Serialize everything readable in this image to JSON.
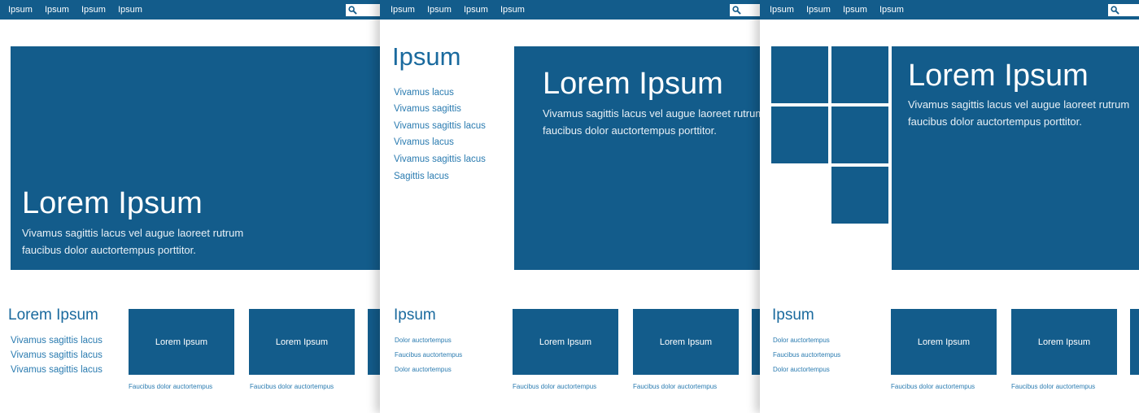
{
  "colors": {
    "brand_blue": "#135c8b",
    "link_blue": "#2a7bb0",
    "background": "#ffffff"
  },
  "panel1": {
    "nav": [
      "Ipsum",
      "Ipsum",
      "Ipsum",
      "Ipsum"
    ],
    "hero": {
      "title": "Lorem Ipsum",
      "desc_line1": "Vivamus sagittis lacus vel augue laoreet rutrum",
      "desc_line2": "faucibus dolor auctortempus porttitor."
    },
    "section": {
      "title": "Lorem Ipsum",
      "links": [
        "Vivamus sagittis lacus",
        "Vivamus sagittis lacus",
        "Vivamus sagittis lacus"
      ]
    },
    "cards": [
      {
        "label": "Lorem Ipsum",
        "caption": "Faucibus dolor auctortempus"
      },
      {
        "label": "Lorem Ipsum",
        "caption": "Faucibus dolor auctortempus"
      },
      {
        "label": "",
        "caption": ""
      }
    ]
  },
  "panel2": {
    "nav": [
      "Ipsum",
      "Ipsum",
      "Ipsum",
      "Ipsum"
    ],
    "sidebar": {
      "title": "Ipsum",
      "links": [
        "Vivamus  lacus",
        "Vivamus sagittis",
        "Vivamus sagittis lacus",
        "Vivamus  lacus",
        "Vivamus sagittis lacus",
        "Sagittis lacus"
      ]
    },
    "hero": {
      "title": "Lorem Ipsum",
      "desc_line1": "Vivamus sagittis lacus vel augue laoreet rutrum",
      "desc_line2": "faucibus dolor auctortempus porttitor."
    },
    "section": {
      "title": "Ipsum",
      "links": [
        "Dolor auctortempus",
        "Faucibus  auctortempus",
        "Dolor auctortempus"
      ]
    },
    "cards": [
      {
        "label": "Lorem Ipsum",
        "caption": "Faucibus dolor auctortempus"
      },
      {
        "label": "Lorem Ipsum",
        "caption": "Faucibus dolor auctortempus"
      },
      {
        "label": "",
        "caption": ""
      }
    ]
  },
  "panel3": {
    "nav": [
      "Ipsum",
      "Ipsum",
      "Ipsum",
      "Ipsum"
    ],
    "hero": {
      "title": "Lorem Ipsum",
      "desc_line1": "Vivamus sagittis lacus vel augue laoreet rutrum",
      "desc_line2": "faucibus dolor auctortempus porttitor."
    },
    "section": {
      "title": "Ipsum",
      "links": [
        "Dolor auctortempus",
        "Faucibus  auctortempus",
        "Dolor auctortempus"
      ]
    },
    "cards": [
      {
        "label": "Lorem Ipsum",
        "caption": "Faucibus dolor auctortempus"
      },
      {
        "label": "Lorem Ipsum",
        "caption": "Faucibus dolor auctortempus"
      },
      {
        "label": "",
        "caption": ""
      }
    ]
  },
  "icons": {
    "search": "search-icon"
  }
}
